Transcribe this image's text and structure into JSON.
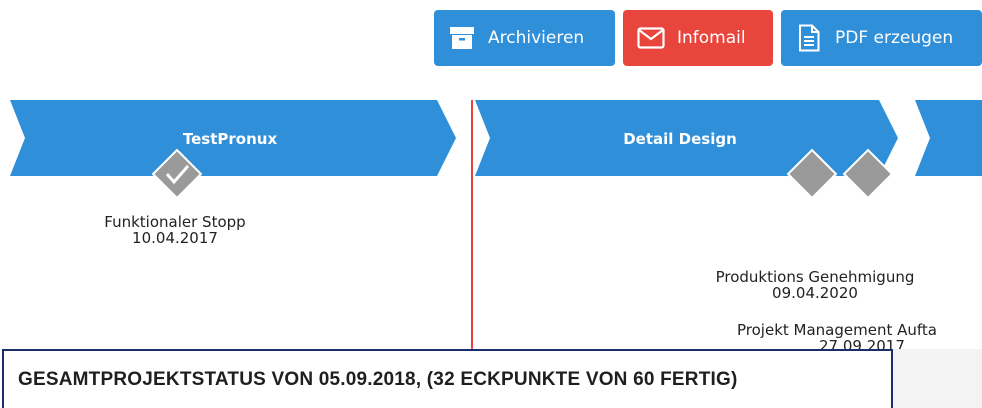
{
  "toolbar": {
    "archive_label": "Archivieren",
    "infomail_label": "Infomail",
    "pdf_label": "PDF erzeugen",
    "archive_icon": "archive-box-icon",
    "infomail_icon": "envelope-icon",
    "pdf_icon": "document-icon"
  },
  "colors": {
    "phase_blue": "#2f8fd8",
    "infomail_red": "#e8453c",
    "today_line": "#e8453c",
    "milestone_gray": "#9a9a9a",
    "status_border": "#1a2e6a"
  },
  "timeline": {
    "phases": [
      {
        "label": "TestPronux"
      },
      {
        "label": "Detail Design"
      },
      {
        "label": ""
      }
    ],
    "milestones": [
      {
        "name": "Funktionaler Stopp",
        "date": "10.04.2017",
        "completed": true
      },
      {
        "name": "Produktions Genehmigung",
        "date": "09.04.2020",
        "completed": false
      },
      {
        "name": "Projekt Management Aufta",
        "date": "27.09.2017",
        "completed": false
      }
    ]
  },
  "status": {
    "text": "GESAMTPROJEKTSTATUS VON 05.09.2018, (32 ECKPUNKTE VON 60 FERTIG)"
  }
}
